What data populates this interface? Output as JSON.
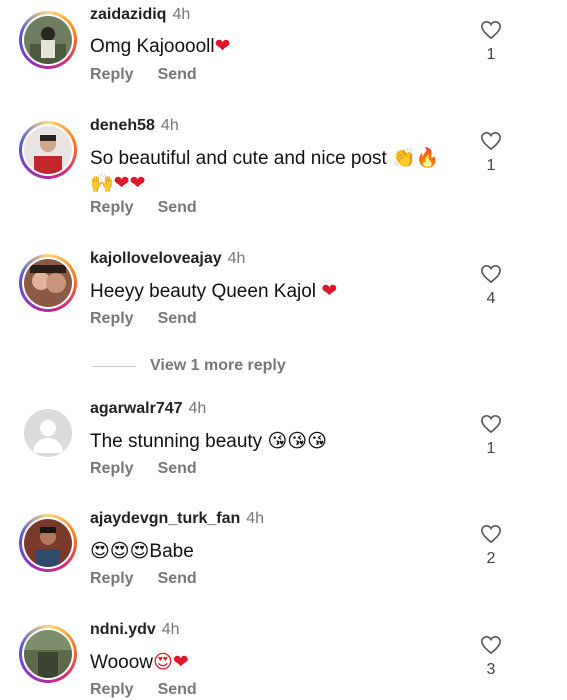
{
  "comments": [
    {
      "username": "zaidazidiq",
      "time": "4h",
      "text": "Omg Kajooooll",
      "text_suffix": "❤",
      "likes": "1",
      "reply": "Reply",
      "send": "Send"
    },
    {
      "username": "deneh58",
      "time": "4h",
      "text": "So beautiful and cute and nice post",
      "text_suffix": "👏🔥",
      "text_line2": "🙌❤❤",
      "likes": "1",
      "reply": "Reply",
      "send": "Send"
    },
    {
      "username": "kajolloveloveajay",
      "time": "4h",
      "text": "Heeyy beauty Queen Kajol",
      "text_suffix": "❤",
      "likes": "4",
      "reply": "Reply",
      "send": "Send"
    },
    {
      "username": "agarwalr747",
      "time": "4h",
      "text": "The stunning beauty",
      "text_suffix": "😘😘😘",
      "likes": "1",
      "reply": "Reply",
      "send": "Send"
    },
    {
      "username": "ajaydevgn_turk_fan",
      "time": "4h",
      "text_prefix": "😍😍😍",
      "text": "Babe",
      "likes": "2",
      "reply": "Reply",
      "send": "Send"
    },
    {
      "username": "ndni.ydv",
      "time": "4h",
      "text": "Wooow",
      "text_suffix": "😍❤",
      "likes": "3",
      "reply": "Reply",
      "send": "Send"
    }
  ],
  "view_more": "View 1 more reply",
  "colors": {
    "heart": "#e0162b",
    "muted": "#777777"
  }
}
